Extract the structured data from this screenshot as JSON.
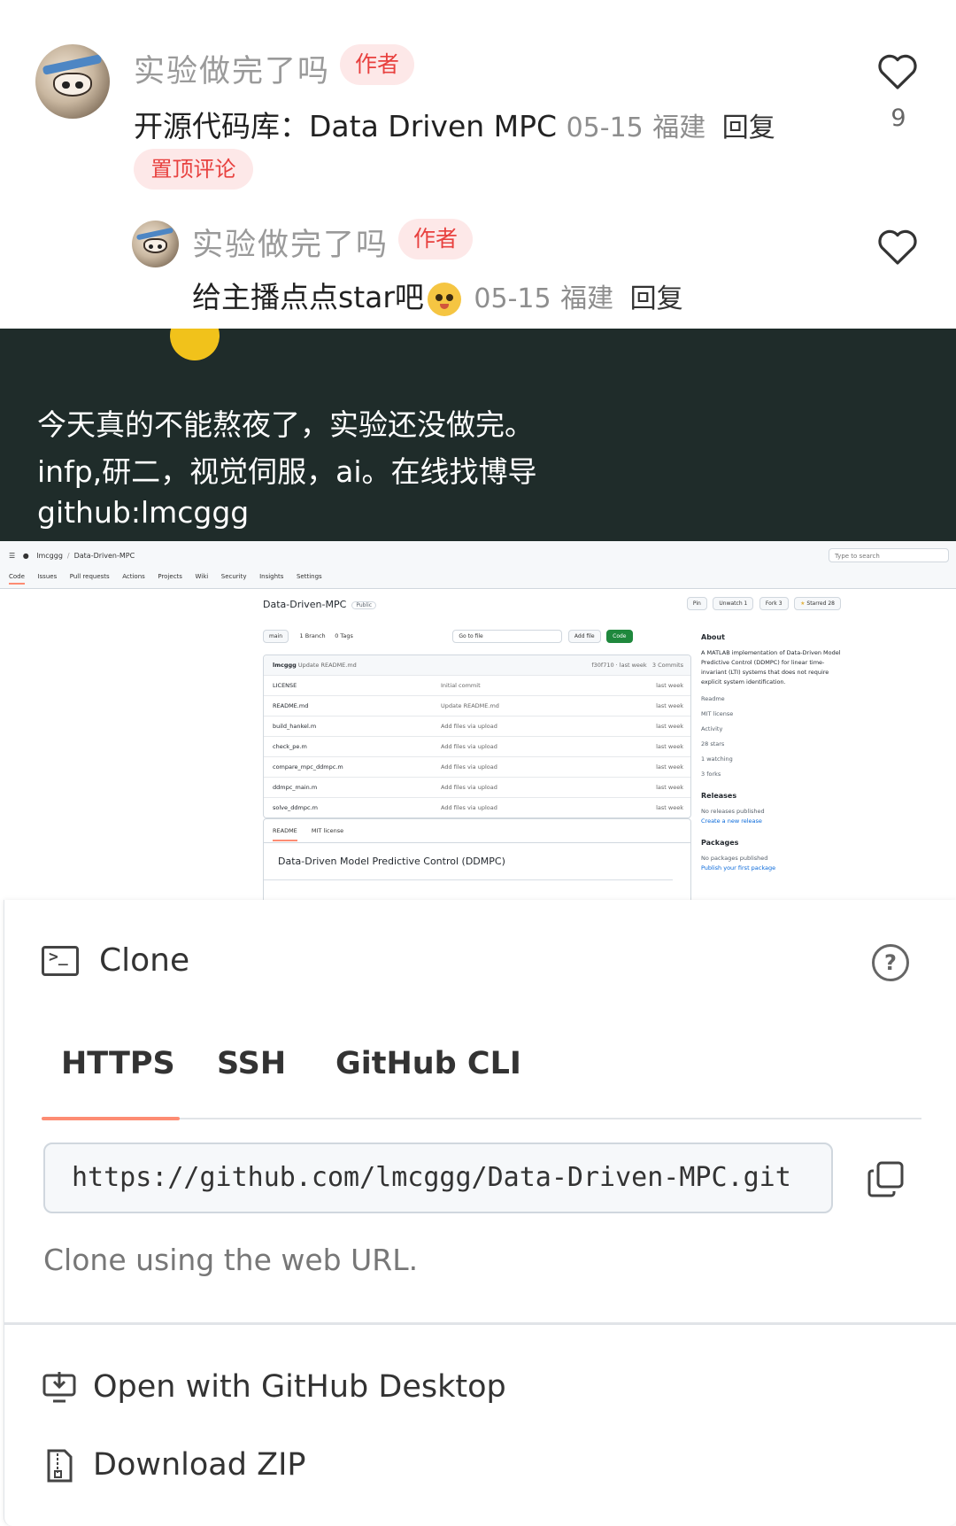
{
  "comments": [
    {
      "username": "实验做完了吗",
      "tag": "作者",
      "text": "开源代码库：Data Driven MPC",
      "date": "05-15",
      "location": "福建",
      "reply_label": "回复",
      "pin_label": "置顶评论",
      "likes": "9"
    },
    {
      "username": "实验做完了吗",
      "tag": "作者",
      "text": "给主播点点star吧",
      "date": "05-15",
      "location": "福建",
      "reply_label": "回复"
    }
  ],
  "banner": {
    "lines": [
      "今天真的不能熬夜了，实验还没做完。",
      "infp,研二，视觉伺服，ai。在线找博导",
      "github:lmcggg"
    ]
  },
  "github": {
    "owner": "lmcggg",
    "repo": "Data-Driven-MPC",
    "search_placeholder": "Type to search",
    "nav_tabs": [
      "Code",
      "Issues",
      "Pull requests",
      "Actions",
      "Projects",
      "Wiki",
      "Security",
      "Insights",
      "Settings"
    ],
    "visibility": "Public",
    "pin_label": "Pin",
    "unwatch_label": "Unwatch",
    "watch_count": "1",
    "fork_label": "Fork",
    "fork_count": "3",
    "starred_label": "Starred",
    "star_count": "28",
    "branch": "main",
    "branch_count": "1 Branch",
    "tags_count": "0 Tags",
    "goto_file": "Go to file",
    "goto_key": "t",
    "add_file": "Add file",
    "code_button": "Code",
    "latest_commit": {
      "author": "lmcggg",
      "message": "Update README.md",
      "hash": "f30f710 · last week",
      "commits": "3 Commits"
    },
    "files": [
      {
        "name": "LICENSE",
        "message": "Initial commit",
        "time": "last week"
      },
      {
        "name": "README.md",
        "message": "Update README.md",
        "time": "last week"
      },
      {
        "name": "build_hankel.m",
        "message": "Add files via upload",
        "time": "last week"
      },
      {
        "name": "check_pe.m",
        "message": "Add files via upload",
        "time": "last week"
      },
      {
        "name": "compare_mpc_ddmpc.m",
        "message": "Add files via upload",
        "time": "last week"
      },
      {
        "name": "ddmpc_main.m",
        "message": "Add files via upload",
        "time": "last week"
      },
      {
        "name": "solve_ddmpc.m",
        "message": "Add files via upload",
        "time": "last week"
      }
    ],
    "readme_tabs": [
      "README",
      "MIT license"
    ],
    "readme_title": "Data-Driven Model Predictive Control (DDMPC)",
    "about": {
      "heading": "About",
      "description": "A MATLAB implementation of Data-Driven Model Predictive Control (DDMPC) for linear time-invariant (LTI) systems that does not require explicit system identification.",
      "items": [
        "Readme",
        "MIT license",
        "Activity",
        "28 stars",
        "1 watching",
        "3 forks"
      ],
      "releases_heading": "Releases",
      "releases_text": "No releases published",
      "releases_link": "Create a new release",
      "packages_heading": "Packages",
      "packages_text": "No packages published",
      "packages_link": "Publish your first package"
    }
  },
  "clone": {
    "title": "Clone",
    "tabs": [
      "HTTPS",
      "SSH",
      "GitHub CLI"
    ],
    "active_tab": "HTTPS",
    "url": "https://github.com/lmcggg/Data-Driven-MPC.git",
    "hint": "Clone using the web URL.",
    "open_desktop": "Open with GitHub Desktop",
    "download_zip": "Download ZIP"
  },
  "colors": {
    "author_tag_bg": "#fde8e8",
    "author_tag_text": "#e8413f",
    "banner_bg": "#1f2c2a",
    "tab_active": "#fd8c73",
    "github_green": "#1f883d"
  }
}
